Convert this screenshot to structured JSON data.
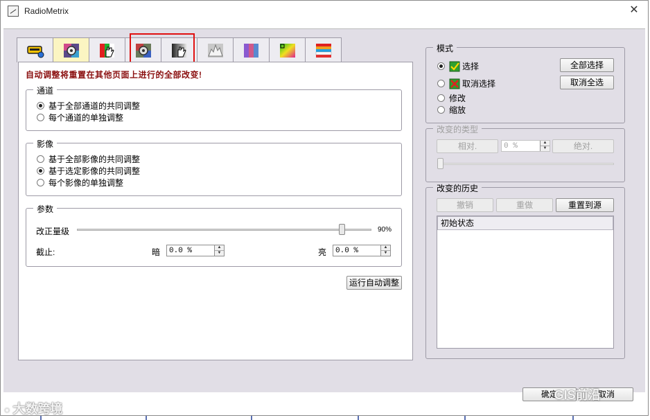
{
  "window": {
    "title": "RadioMetrix"
  },
  "tabs": [
    {
      "name": "tab-scanner",
      "icon": "scanner-icon"
    },
    {
      "name": "tab-auto-adjust",
      "icon": "gear-icon"
    },
    {
      "name": "tab-hand-adjust",
      "icon": "hand-icon"
    },
    {
      "name": "tab-gear-adjust-2",
      "icon": "gear-icon"
    },
    {
      "name": "tab-hand-adjust-2",
      "icon": "hand-icon"
    },
    {
      "name": "tab-histogram",
      "icon": "histogram-icon"
    },
    {
      "name": "tab-channels",
      "icon": "channels-icon"
    },
    {
      "name": "tab-color-map",
      "icon": "color-map-icon"
    },
    {
      "name": "tab-color-bars",
      "icon": "color-bars-icon"
    }
  ],
  "auto_panel": {
    "warning": "自动调整将重置在其他页面上进行的全部改变!",
    "channel": {
      "legend": "通道",
      "options": [
        "基于全部通道的共同调整",
        "每个通道的单独调整"
      ],
      "selected": 0
    },
    "image": {
      "legend": "影像",
      "options": [
        "基于全部影像的共同调整",
        "基于选定影像的共同调整",
        "每个影像的单独调整"
      ],
      "selected": 1
    },
    "params": {
      "legend": "参数",
      "correction_label": "改正量级",
      "correction_value": "90%",
      "correction_level": 0.9,
      "cutoff_label": "截止:",
      "dark_label": "暗",
      "dark_value": "0.0 %",
      "bright_label": "亮",
      "bright_value": "0.0 %"
    },
    "run_button": "运行自动调整"
  },
  "mode": {
    "legend": "模式",
    "options": [
      "选择",
      "取消选择",
      "修改",
      "缩放"
    ],
    "selected": 0,
    "select_all_button": "全部选择",
    "deselect_all_button": "取消全选"
  },
  "change_type": {
    "legend": "改变的类型",
    "relative_button": "相对.",
    "value": "0 %",
    "absolute_button": "绝对."
  },
  "history": {
    "legend": "改变的历史",
    "undo_button": "撤销",
    "redo_button": "重做",
    "reset_button": "重置到源",
    "items": [
      "初始状态"
    ]
  },
  "footer": {
    "ok_button": "确定",
    "cancel_button": "取消"
  },
  "watermarks": {
    "left": "大数跨境",
    "right": "GIS前沿"
  },
  "colors": {
    "warning": "#8b1010",
    "highlight": "#e01010",
    "active_tab": "#fbf5c2",
    "client_bg": "#e1dee6"
  }
}
